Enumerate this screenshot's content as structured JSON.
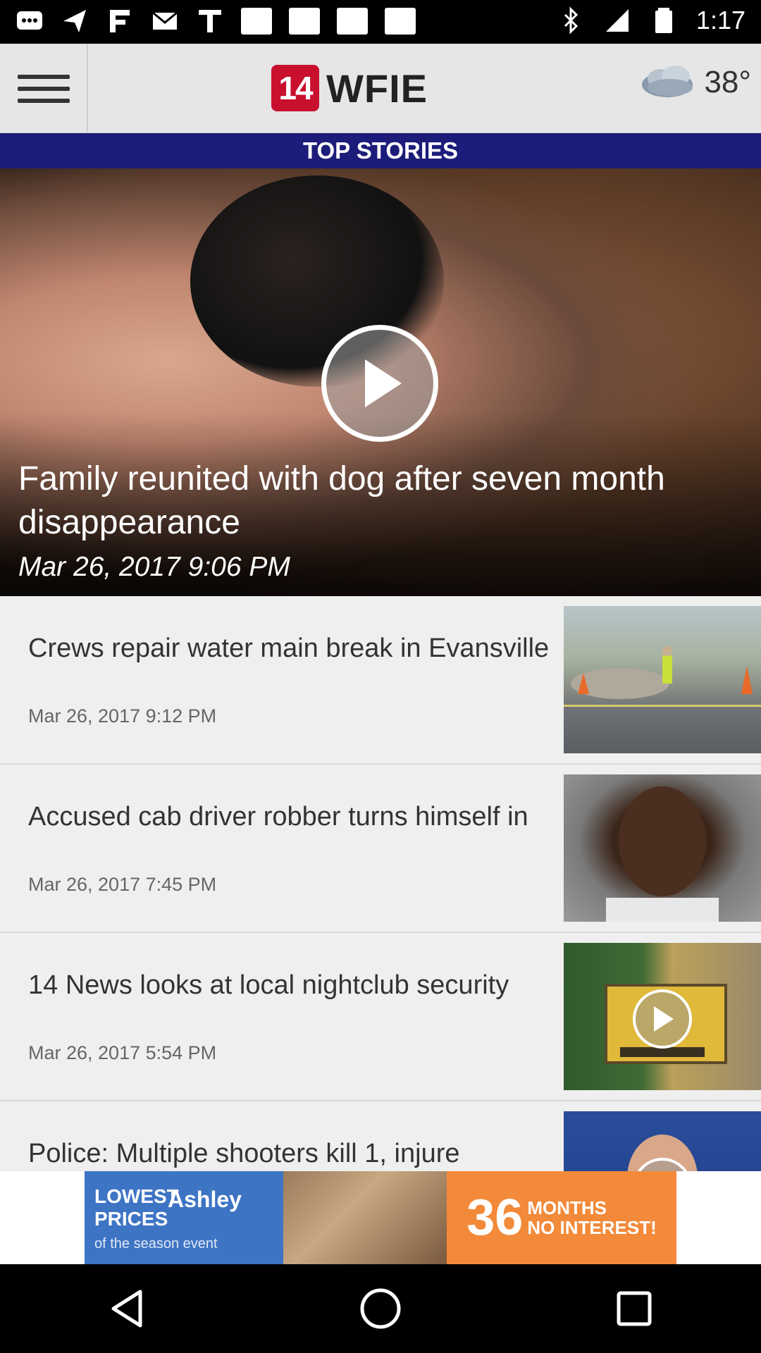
{
  "status_bar": {
    "time": "1:17"
  },
  "header": {
    "logo_number": "14",
    "logo_text": "WFIE",
    "weather_temp": "38°"
  },
  "section": {
    "title": "TOP STORIES"
  },
  "hero": {
    "title": "Family reunited with dog after seven month disappearance",
    "date": "Mar 26, 2017 9:06 PM"
  },
  "stories": [
    {
      "title": "Crews repair water main break in Evansville",
      "date": "Mar 26, 2017 9:12 PM",
      "has_video": false
    },
    {
      "title": "Accused cab driver robber turns himself in",
      "date": "Mar 26, 2017 7:45 PM",
      "has_video": false
    },
    {
      "title": "14 News looks at local nightclub security",
      "date": "Mar 26, 2017 5:54 PM",
      "has_video": true
    },
    {
      "title": "Police: Multiple shooters kill 1, injure",
      "date": "",
      "has_video": true
    }
  ],
  "ad": {
    "left_line1": "LOWEST",
    "left_line2": "PRICES",
    "brand": "Ashley",
    "sub": "of the season event",
    "big": "36",
    "small_line1": "MONTHS",
    "small_line2": "NO INTEREST!"
  },
  "colors": {
    "section_bar": "#1c1c7a",
    "logo_red": "#c8102e",
    "ad_blue": "#3e74c4",
    "ad_orange": "#f28a3a"
  }
}
